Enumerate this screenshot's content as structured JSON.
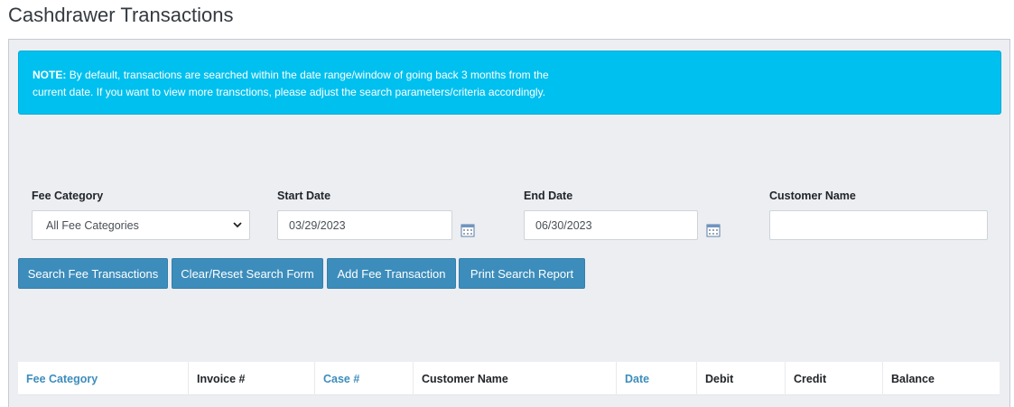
{
  "page": {
    "title": "Cashdrawer Transactions"
  },
  "alert": {
    "prefix": "NOTE:",
    "line1": "By default, transactions are searched within the date range/window of going back 3 months from the",
    "line2": "current date. If you want to view more transctions, please adjust the search parameters/criteria accordingly."
  },
  "form": {
    "fee_category": {
      "label": "Fee Category",
      "value": "All Fee Categories"
    },
    "start_date": {
      "label": "Start Date",
      "value": "03/29/2023"
    },
    "end_date": {
      "label": "End Date",
      "value": "06/30/2023"
    },
    "customer_name": {
      "label": "Customer Name",
      "value": ""
    }
  },
  "buttons": {
    "search": "Search Fee Transactions",
    "clear": "Clear/Reset Search Form",
    "add": "Add Fee Transaction",
    "print": "Print Search Report"
  },
  "table": {
    "headers": [
      "Fee Category",
      "Invoice #",
      "Case #",
      "Customer Name",
      "Date",
      "Debit",
      "Credit",
      "Balance"
    ]
  },
  "colors": {
    "accent": "#3c8dbc",
    "alert": "#00c0ef",
    "panel": "#eceef2"
  },
  "icons": {
    "calendar": "calendar-icon",
    "select": "chevron-down-icon"
  }
}
